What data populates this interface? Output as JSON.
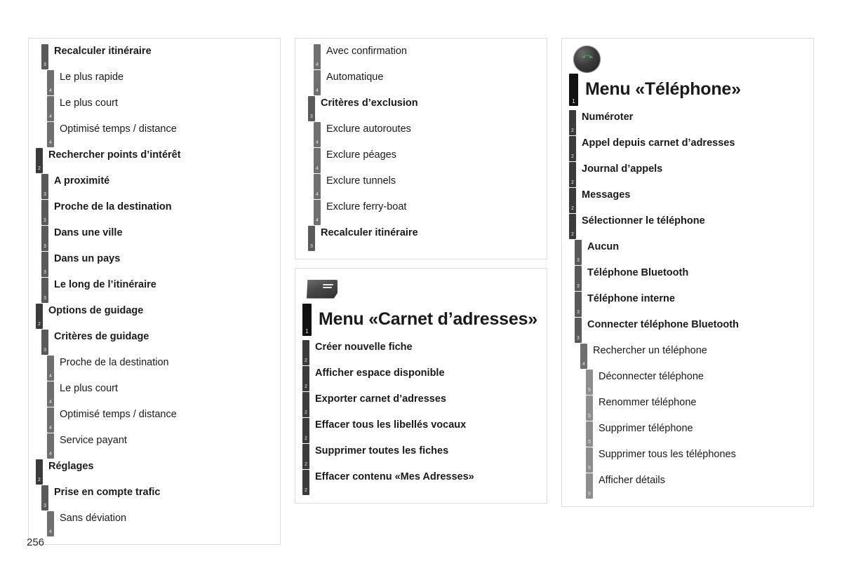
{
  "page": {
    "number": "256"
  },
  "columns": [
    {
      "name": "left",
      "boxes": [
        {
          "icon": null,
          "entries": [
            {
              "level": 3,
              "label": "Recalculer itinéraire"
            },
            {
              "level": 4,
              "label": "Le plus rapide"
            },
            {
              "level": 4,
              "label": "Le plus court"
            },
            {
              "level": 4,
              "label": "Optimisé temps / distance"
            },
            {
              "level": 2,
              "label": "Rechercher points d’intérêt"
            },
            {
              "level": 3,
              "label": "A proximité"
            },
            {
              "level": 3,
              "label": "Proche de la destination"
            },
            {
              "level": 3,
              "label": "Dans une ville"
            },
            {
              "level": 3,
              "label": "Dans un pays"
            },
            {
              "level": 3,
              "label": "Le long de l’itinéraire"
            },
            {
              "level": 2,
              "label": "Options de guidage"
            },
            {
              "level": 3,
              "label": "Critères de guidage"
            },
            {
              "level": 4,
              "label": "Proche de la destination"
            },
            {
              "level": 4,
              "label": "Le plus court"
            },
            {
              "level": 4,
              "label": "Optimisé temps / distance"
            },
            {
              "level": 4,
              "label": "Service payant"
            },
            {
              "level": 2,
              "label": "Réglages"
            },
            {
              "level": 3,
              "label": "Prise en compte trafic"
            },
            {
              "level": 4,
              "label": "Sans déviation"
            }
          ]
        }
      ]
    },
    {
      "name": "middle",
      "boxes": [
        {
          "icon": null,
          "entries": [
            {
              "level": 4,
              "label": "Avec confirmation"
            },
            {
              "level": 4,
              "label": "Automatique"
            },
            {
              "level": 3,
              "label": "Critères d’exclusion"
            },
            {
              "level": 4,
              "label": "Exclure autoroutes"
            },
            {
              "level": 4,
              "label": "Exclure péages"
            },
            {
              "level": 4,
              "label": "Exclure tunnels"
            },
            {
              "level": 4,
              "label": "Exclure ferry-boat"
            },
            {
              "level": 3,
              "label": "Recalculer itinéraire"
            }
          ]
        },
        {
          "icon": "address-book-icon",
          "entries": [
            {
              "level": 1,
              "label": "Menu «Carnet d’adresses»"
            },
            {
              "level": 2,
              "label": "Créer nouvelle fiche"
            },
            {
              "level": 2,
              "label": "Afficher espace disponible"
            },
            {
              "level": 2,
              "label": "Exporter carnet d’adresses"
            },
            {
              "level": 2,
              "label": "Effacer tous les libellés vocaux"
            },
            {
              "level": 2,
              "label": "Supprimer toutes les fiches"
            },
            {
              "level": 2,
              "label": "Effacer contenu «Mes Adresses»"
            }
          ]
        }
      ]
    },
    {
      "name": "right",
      "boxes": [
        {
          "icon": "phone-icon",
          "entries": [
            {
              "level": 1,
              "label": "Menu «Téléphone»"
            },
            {
              "level": 2,
              "label": "Numéroter"
            },
            {
              "level": 2,
              "label": "Appel depuis carnet d’adresses"
            },
            {
              "level": 2,
              "label": "Journal d’appels"
            },
            {
              "level": 2,
              "label": "Messages"
            },
            {
              "level": 2,
              "label": "Sélectionner le téléphone"
            },
            {
              "level": 3,
              "label": "Aucun"
            },
            {
              "level": 3,
              "label": "Téléphone Bluetooth"
            },
            {
              "level": 3,
              "label": "Téléphone interne"
            },
            {
              "level": 3,
              "label": "Connecter téléphone Bluetooth"
            },
            {
              "level": 4,
              "label": "Rechercher un téléphone"
            },
            {
              "level": 5,
              "label": "Déconnecter téléphone"
            },
            {
              "level": 5,
              "label": "Renommer téléphone"
            },
            {
              "level": 5,
              "label": "Supprimer téléphone"
            },
            {
              "level": 5,
              "label": "Supprimer tous les téléphones"
            },
            {
              "level": 5,
              "label": "Afficher détails"
            }
          ]
        }
      ]
    }
  ],
  "colors": {
    "level1_marker": "#111111",
    "level2_marker": "#3b3b3b",
    "level3_marker": "#5a5a5a",
    "level4_marker": "#6f6f6f",
    "level5_marker": "#8d8d8d",
    "box_border": "#dcdcdc",
    "text": "#1a1a1a",
    "phone_icon_accent": "#3f9d5e"
  }
}
